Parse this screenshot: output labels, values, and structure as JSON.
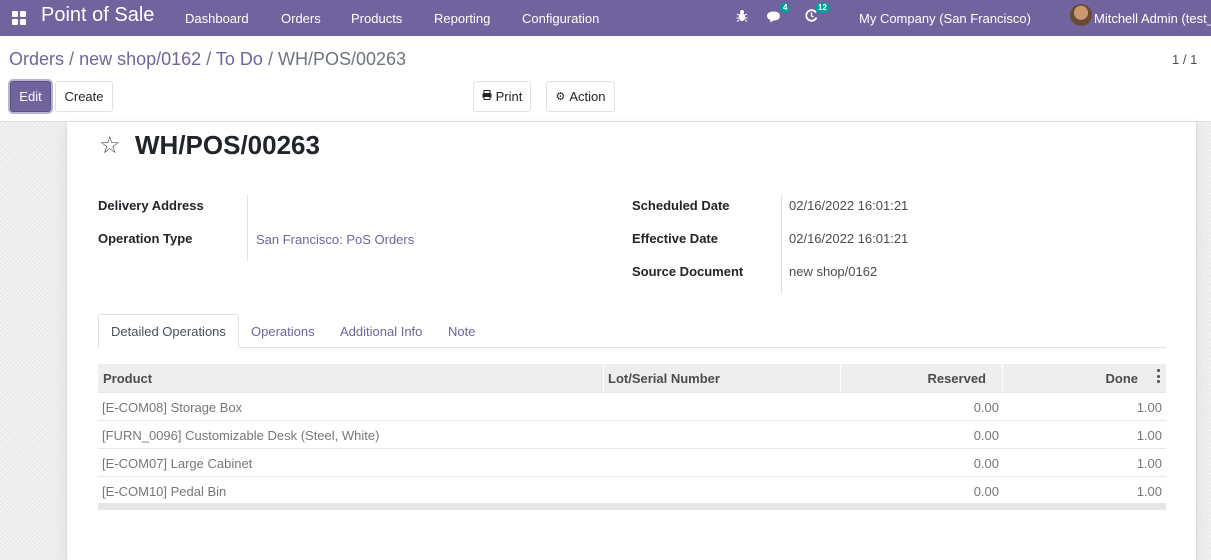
{
  "navbar": {
    "app_name": "Point of Sale",
    "menu": [
      "Dashboard",
      "Orders",
      "Products",
      "Reporting",
      "Configuration"
    ],
    "messages_count": "4",
    "activities_count": "12",
    "company": "My Company (San Francisco)",
    "user": "Mitchell Admin (test_"
  },
  "breadcrumb": {
    "items": [
      "Orders",
      "new shop/0162",
      "To Do"
    ],
    "separator": "/",
    "current": "WH/POS/00263"
  },
  "buttons": {
    "edit": "Edit",
    "create": "Create",
    "print": "Print",
    "action": "Action"
  },
  "pager": "1 / 1",
  "record": {
    "title": "WH/POS/00263",
    "delivery_address_label": "Delivery Address",
    "delivery_address": "",
    "operation_type_label": "Operation Type",
    "operation_type": "San Francisco: PoS Orders",
    "scheduled_date_label": "Scheduled Date",
    "scheduled_date": "02/16/2022 16:01:21",
    "effective_date_label": "Effective Date",
    "effective_date": "02/16/2022 16:01:21",
    "source_document_label": "Source Document",
    "source_document": "new shop/0162"
  },
  "tabs": [
    "Detailed Operations",
    "Operations",
    "Additional Info",
    "Note"
  ],
  "table": {
    "columns": [
      "Product",
      "Lot/Serial Number",
      "Reserved",
      "Done"
    ],
    "rows": [
      {
        "product": "[E-COM08] Storage Box",
        "lot": "",
        "reserved": "0.00",
        "done": "1.00"
      },
      {
        "product": "[FURN_0096] Customizable Desk (Steel, White)",
        "lot": "",
        "reserved": "0.00",
        "done": "1.00"
      },
      {
        "product": "[E-COM07] Large Cabinet",
        "lot": "",
        "reserved": "0.00",
        "done": "1.00"
      },
      {
        "product": "[E-COM10] Pedal Bin",
        "lot": "",
        "reserved": "0.00",
        "done": "1.00"
      }
    ]
  },
  "colors": {
    "brand": "#71639e",
    "badge": "#00a09d",
    "text": "#4c4c4c"
  },
  "icons": {
    "apps": "apps-grid-icon",
    "debug": "bug-icon",
    "messages": "chat-icon",
    "activities": "clock-icon",
    "favorite": "star-icon",
    "print": "print-icon",
    "action": "gear-icon",
    "optional_columns": "kebab-menu-icon"
  }
}
